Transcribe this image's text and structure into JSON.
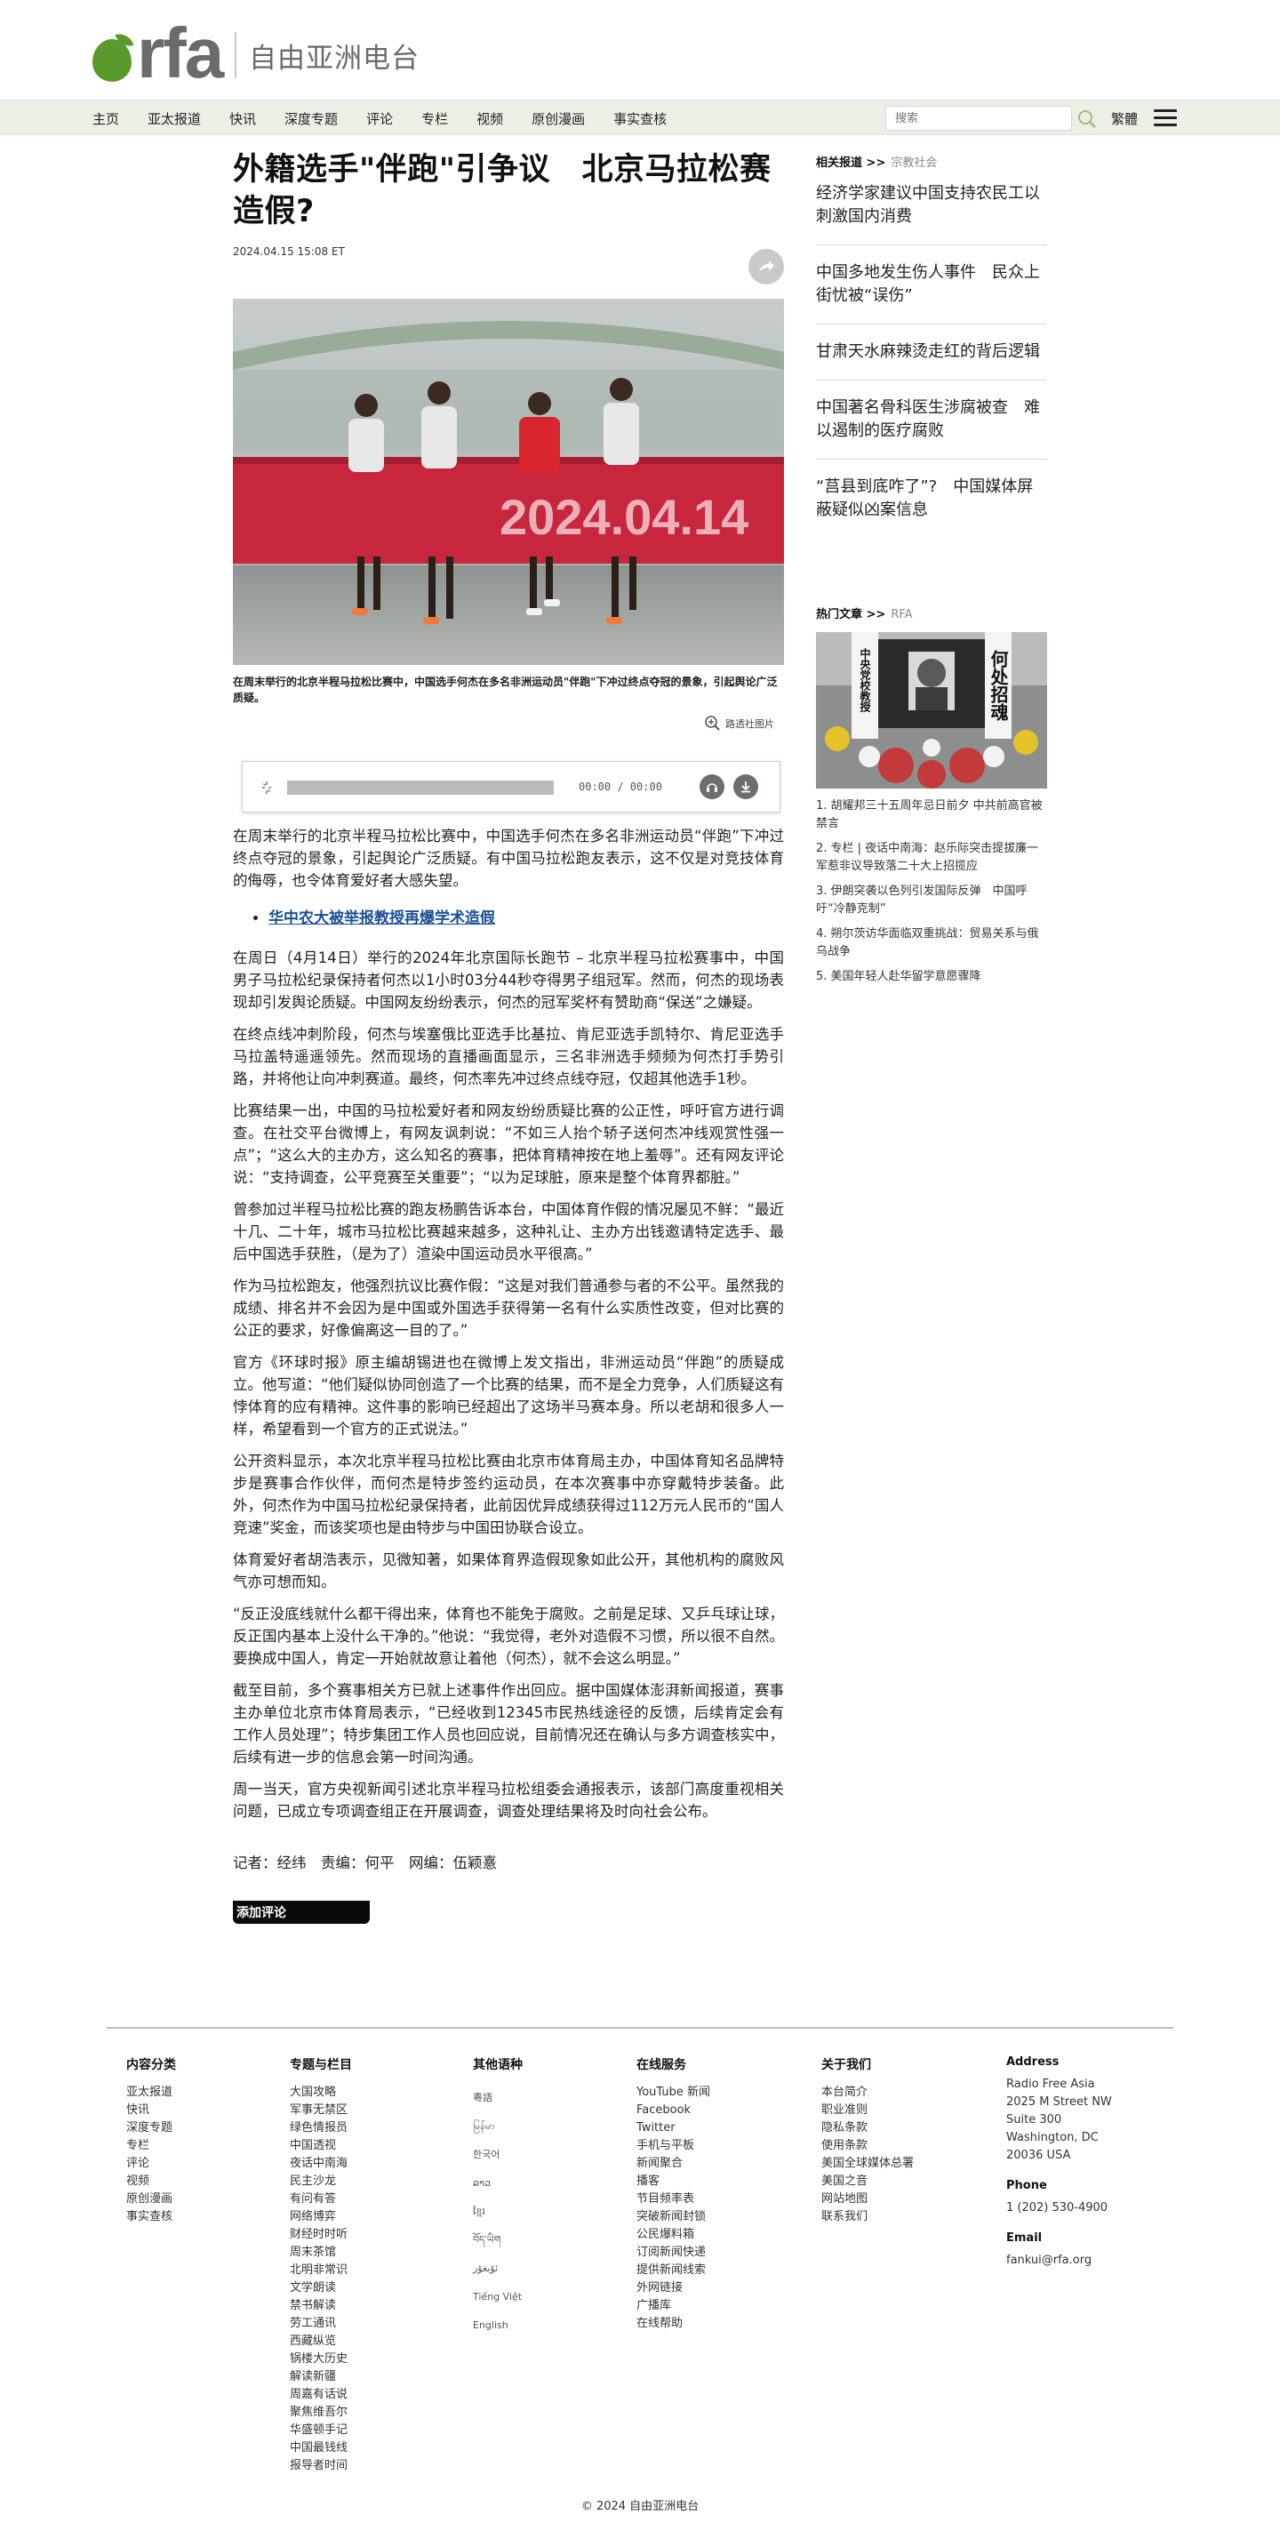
{
  "site": {
    "logo_text": "rfa",
    "logo_cn": "自由亚洲电台",
    "brand_color": "#5a9a2c"
  },
  "nav": {
    "items": [
      "主页",
      "亚太报道",
      "快讯",
      "深度专题",
      "评论",
      "专栏",
      "视频",
      "原创漫画",
      "事实查核"
    ],
    "search_placeholder": "搜索",
    "lang_switch": "繁體"
  },
  "article": {
    "headline": "外籍选手\"伴跑\"引争议　北京马拉松赛造假?",
    "timestamp": "2024.04.15 15:08 ET",
    "photo_banner_text": "2024.04.14",
    "caption": "在周末举行的北京半程马拉松比赛中，中国选手何杰在多名非洲运动员\"伴跑\"下冲过终点夺冠的景象，引起舆论广泛质疑。",
    "zoom_label": "路透社图片",
    "audio_time": "00:00 / 00:00",
    "lead": "在周末举行的北京半程马拉松比赛中，中国选手何杰在多名非洲运动员“伴跑”下冲过终点夺冠的景象，引起舆论广泛质疑。有中国马拉松跑友表示，这不仅是对竞技体育的侮辱，也令体育爱好者大感失望。",
    "related_link": "华中农大被举报教授再爆学术造假",
    "paragraphs": [
      "在周日（4月14日）举行的2024年北京国际长跑节 – 北京半程马拉松赛事中，中国男子马拉松纪录保持者何杰以1小时03分44秒夺得男子组冠军。然而，何杰的现场表现却引发舆论质疑。中国网友纷纷表示，何杰的冠军奖杯有赞助商“保送”之嫌疑。",
      "在终点线冲刺阶段，何杰与埃塞俄比亚选手比基拉、肯尼亚选手凯特尔、肯尼亚选手马拉盖特遥遥领先。然而现场的直播画面显示，三名非洲选手频频为何杰打手势引路，并将他让向冲刺赛道。最终，何杰率先冲过终点线夺冠，仅超其他选手1秒。",
      "比赛结果一出，中国的马拉松爱好者和网友纷纷质疑比赛的公正性，呼吁官方进行调查。在社交平台微博上，有网友讽刺说：“不如三人抬个轿子送何杰冲线观赏性强一点”；“这么大的主办方，这么知名的赛事，把体育精神按在地上羞辱”。还有网友评论说：“支持调查，公平竞赛至关重要”；“以为足球脏，原来是整个体育界都脏。”",
      "曾参加过半程马拉松比赛的跑友杨鹏告诉本台，中国体育作假的情况屡见不鲜：“最近十几、二十年，城市马拉松比赛越来越多，这种礼让、主办方出钱邀请特定选手、最后中国选手获胜，（是为了）渲染中国运动员水平很高。”",
      "作为马拉松跑友，他强烈抗议比赛作假：“这是对我们普通参与者的不公平。虽然我的成绩、排名并不会因为是中国或外国选手获得第一名有什么实质性改变，但对比赛的公正的要求，好像偏离这一目的了。”",
      "官方《环球时报》原主编胡锡进也在微博上发文指出，非洲运动员“伴跑”的质疑成立。他写道：“他们疑似协同创造了一个比赛的结果，而不是全力竞争，人们质疑这有悖体育的应有精神。这件事的影响已经超出了这场半马赛本身。所以老胡和很多人一样，希望看到一个官方的正式说法。”",
      "公开资料显示，本次北京半程马拉松比赛由北京市体育局主办，中国体育知名品牌特步是赛事合作伙伴，而何杰是特步签约运动员，在本次赛事中亦穿戴特步装备。此外，何杰作为中国马拉松纪录保持者，此前因优异成绩获得过112万元人民币的“国人竞速”奖金，而该奖项也是由特步与中国田协联合设立。",
      "体育爱好者胡浩表示，见微知著，如果体育界造假现象如此公开，其他机构的腐败风气亦可想而知。",
      "“反正没底线就什么都干得出来，体育也不能免于腐败。之前是足球、又乒乓球让球，反正国内基本上没什么干净的。”他说：“我觉得，老外对造假不习惯，所以很不自然。要换成中国人，肯定一开始就故意让着他（何杰），就不会这么明显。”",
      "截至目前，多个赛事相关方已就上述事件作出回应。据中国媒体澎湃新闻报道，赛事主办单位北京市体育局表示，“已经收到12345市民热线途径的反馈，后续肯定会有工作人员处理”；特步集团工作人员也回应说，目前情况还在确认与多方调查核实中，后续有进一步的信息会第一时间沟通。",
      "周一当天，官方央视新闻引述北京半程马拉松组委会通报表示，该部门高度重视相关问题，已成立专项调查组正在开展调查，调查处理结果将及时向社会公布。"
    ],
    "credits": "记者：经纬　责编：何平　网编：伍颖憙",
    "comment_button": "添加评论"
  },
  "sidebar": {
    "related_title": "相关报道 >>",
    "related_tag": "宗教社会",
    "related_items": [
      "经济学家建议中国支持农民工以刺激国内消费",
      "中国多地发生伤人事件　民众上街忧被“误伤”",
      "甘肃天水麻辣烫走红的背后逻辑",
      "中国著名骨科医生涉腐被查　难以遏制的医疗腐败",
      "“莒县到底咋了”?　中国媒体屏蔽疑似凶案信息"
    ],
    "popular_title": "热门文章 >>",
    "popular_tag": "RFA",
    "popular_image_text_left": "中央党校教授",
    "popular_image_text_right": "何处招魂",
    "popular_items": [
      "1. 胡耀邦三十五周年忌日前夕 中共前高官被禁言",
      "2. 专栏 | 夜话中南海：赵乐际突击提拔廉一军惹非议导致落二十大上招揽应",
      "3. 伊朗突袭以色列引发国际反弹　中国呼吁“冷静克制”",
      "4. 朔尔茨访华面临双重挑战：贸易关系与俄乌战争",
      "5. 美国年轻人赴华留学意愿骤降"
    ]
  },
  "footer": {
    "col1_title": "内容分类",
    "col1_items": [
      "亚太报道",
      "快讯",
      "深度专题",
      "专栏",
      "评论",
      "视频",
      "原创漫画",
      "事实查核"
    ],
    "col2_title": "专题与栏目",
    "col2_items": [
      "大国攻略",
      "军事无禁区",
      "绿色情报员",
      "中国透视",
      "夜话中南海",
      "民主沙龙",
      "有问有答",
      "网络博弈",
      "财经时时听",
      "周末茶馆",
      "北明非常识",
      "文学朗读",
      "禁书解读",
      "劳工通讯",
      "西藏纵览",
      "锅楼大历史",
      "解读新疆",
      "周嘉有话说",
      "聚焦维吾尔",
      "华盛顿手记",
      "中国最钱线",
      "报导者时间"
    ],
    "col3_title": "其他语种",
    "col3_items": [
      "粵語",
      "မြန်မာ",
      "한국어",
      "ລາວ",
      "ខ្មែរ",
      "བོད་ཡིག",
      "ئۇيغۇر",
      "Tiếng Việt",
      "English"
    ],
    "col4_title": "在线服务",
    "col4_items": [
      "YouTube 新闻",
      "Facebook",
      "Twitter",
      "手机与平板",
      "新闻聚合",
      "播客",
      "节目频率表",
      "突破新闻封锁",
      "公民爆料箱",
      "订阅新闻快递",
      "提供新闻线索",
      "外网链接",
      "广播库",
      "在线帮助"
    ],
    "col5_title": "关于我们",
    "col5_items": [
      "本台简介",
      "职业准则",
      "隐私条款",
      "使用条款",
      "美国全球媒体总署",
      "美国之音",
      "网站地图",
      "联系我们"
    ],
    "address_title": "Address",
    "address_lines": [
      "Radio Free Asia",
      "2025 M Street NW",
      "Suite 300",
      "Washington, DC",
      "20036 USA"
    ],
    "phone_title": "Phone",
    "phone": "1 (202) 530-4900",
    "email_title": "Email",
    "email": "fankui@rfa.org",
    "copyright": "© 2024 自由亚洲电台"
  }
}
